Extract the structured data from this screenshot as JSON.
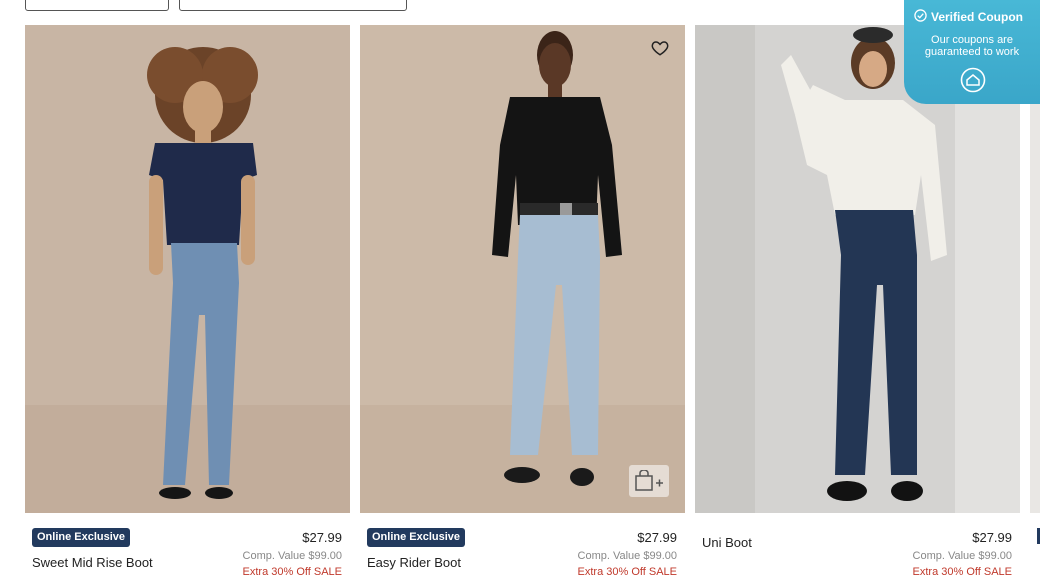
{
  "coupon": {
    "title": "Verified Coupon",
    "line1": "Our coupons are",
    "line2": "guaranteed to work",
    "icons": [
      "check-circle-icon",
      "home-logo-icon"
    ],
    "accent": "#3aa6c9"
  },
  "products": [
    {
      "badge": "Online Exclusive",
      "name": "Sweet Mid Rise Boot",
      "price": "$27.99",
      "comp_value": "Comp. Value $99.00",
      "sale": "Extra 30% Off SALE"
    },
    {
      "badge": "Online Exclusive",
      "name": "Easy Rider Boot",
      "price": "$27.99",
      "comp_value": "Comp. Value $99.00",
      "sale": "Extra 30% Off SALE",
      "icons": [
        "heart-icon",
        "add-to-bag-icon"
      ]
    },
    {
      "name": "Uni Boot",
      "price": "$27.99",
      "comp_value": "Comp. Value $99.00",
      "sale": "Extra 30% Off SALE"
    }
  ],
  "colors": {
    "badge_bg": "#223a5e",
    "sale_red": "#c0392b"
  }
}
